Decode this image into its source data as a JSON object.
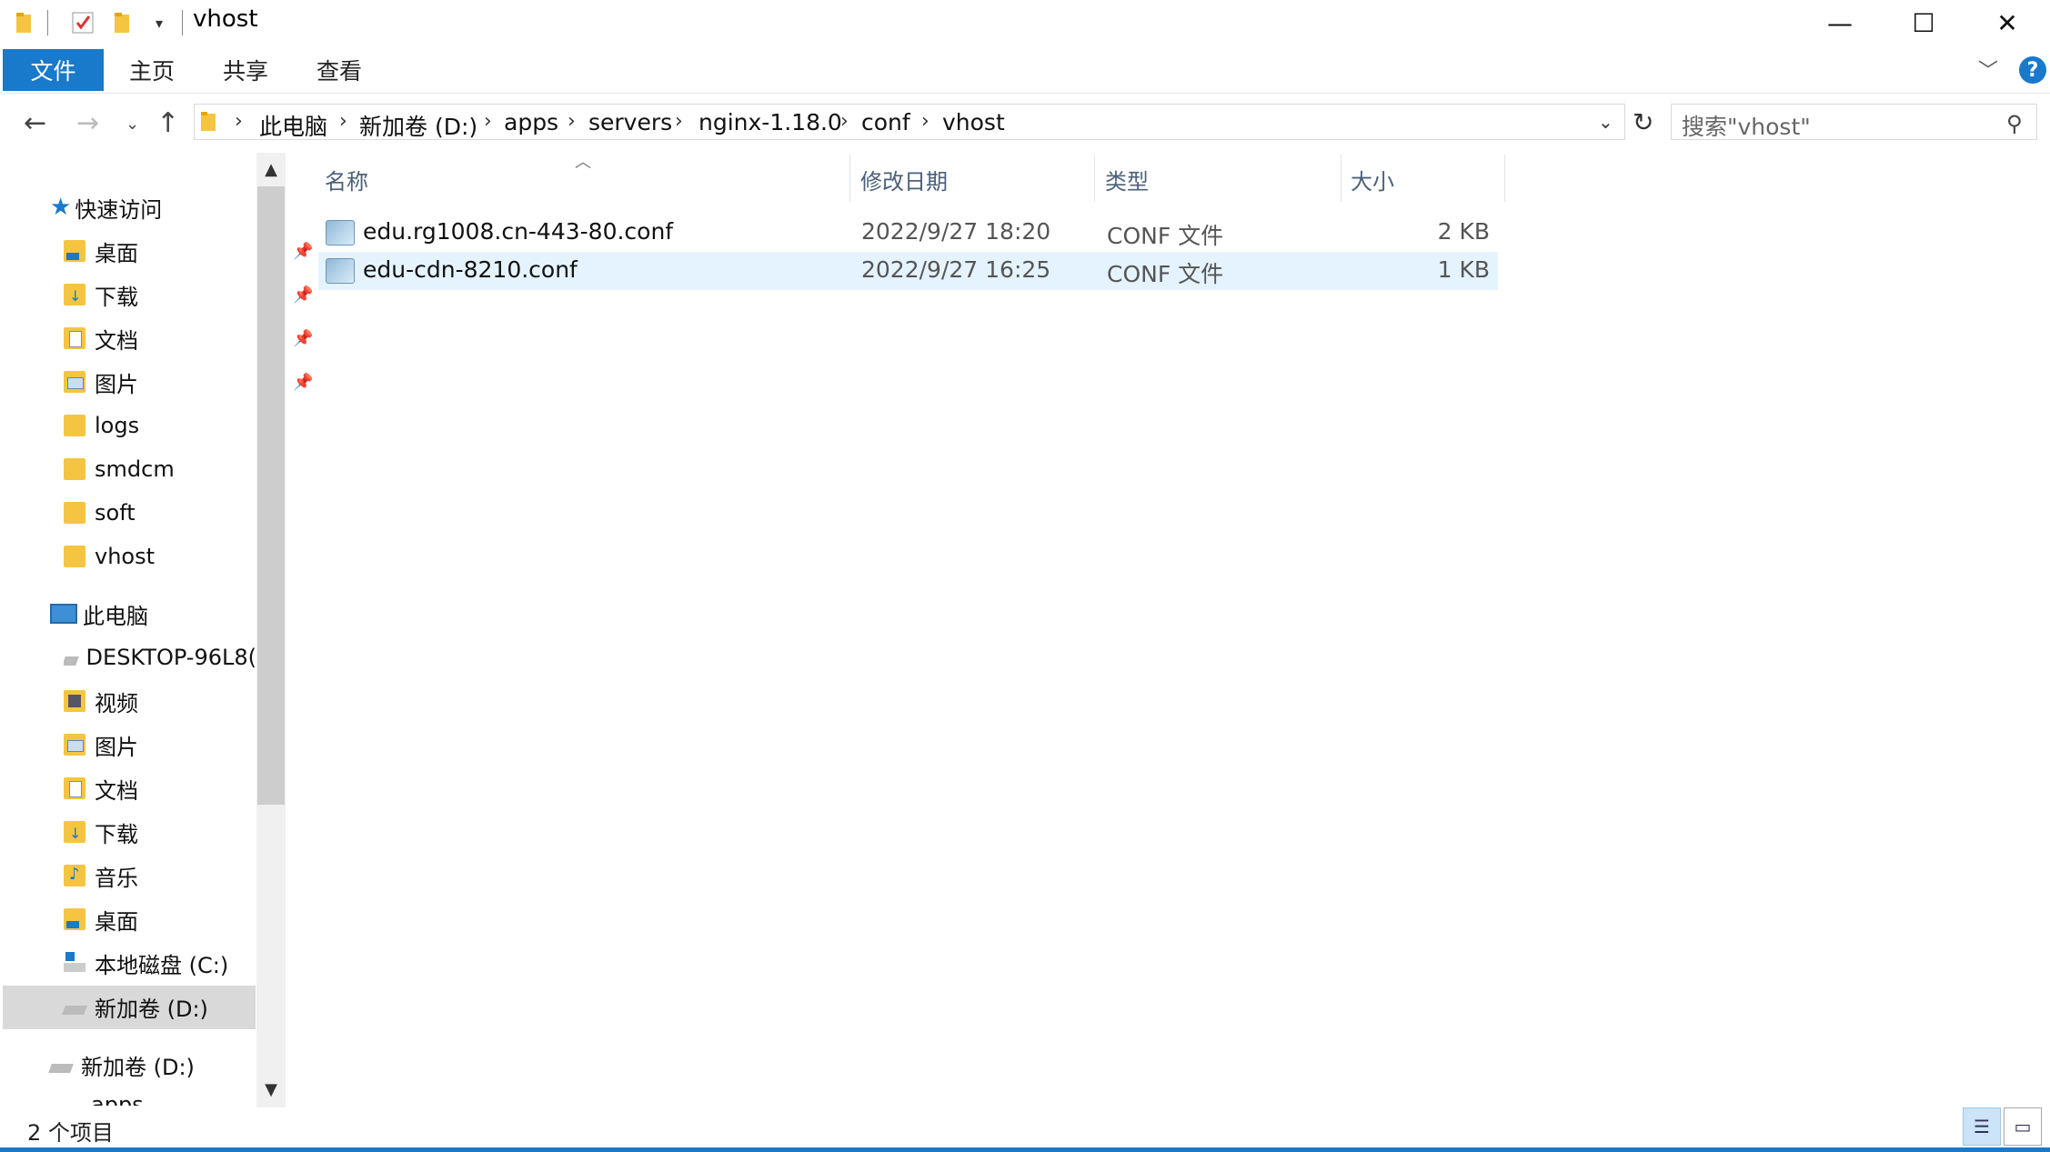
{
  "window": {
    "title": "vhost"
  },
  "ribbon": {
    "tabs": [
      "文件",
      "主页",
      "共享",
      "查看"
    ],
    "help": "?"
  },
  "address": {
    "crumbs": [
      "此电脑",
      "新加卷 (D:)",
      "apps",
      "servers",
      "nginx-1.18.0",
      "conf",
      "vhost"
    ]
  },
  "search": {
    "placeholder": "搜索\"vhost\""
  },
  "nav": {
    "quick_access": "快速访问",
    "quick_items": [
      "桌面",
      "下载",
      "文档",
      "图片",
      "logs",
      "smdcm",
      "soft",
      "vhost"
    ],
    "this_pc": "此电脑",
    "pc_items": [
      "DESKTOP-96L8(",
      "视频",
      "图片",
      "文档",
      "下载",
      "音乐",
      "桌面",
      "本地磁盘 (C:)",
      "新加卷 (D:)"
    ],
    "drive": "新加卷 (D:)",
    "partial": "apps"
  },
  "columns": {
    "name": "名称",
    "date": "修改日期",
    "type": "类型",
    "size": "大小"
  },
  "files": [
    {
      "name": "edu.rg1008.cn-443-80.conf",
      "date": "2022/9/27 18:20",
      "type": "CONF 文件",
      "size": "2 KB"
    },
    {
      "name": "edu-cdn-8210.conf",
      "date": "2022/9/27 16:25",
      "type": "CONF 文件",
      "size": "1 KB"
    }
  ],
  "status": {
    "count": "2 个项目"
  },
  "colors": {
    "accent": "#1979ca",
    "selection": "#e5f3ff",
    "folder": "#f5c542"
  }
}
